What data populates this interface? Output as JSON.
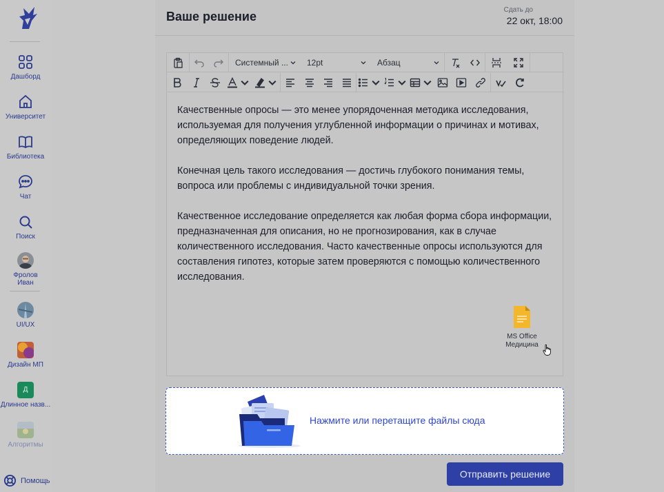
{
  "sidebar": {
    "items": [
      {
        "label": "Дашборд",
        "icon": "grid-icon"
      },
      {
        "label": "Университет",
        "icon": "home-icon"
      },
      {
        "label": "Библиотека",
        "icon": "book-icon"
      },
      {
        "label": "Чат",
        "icon": "chat-icon"
      },
      {
        "label": "Поиск",
        "icon": "search-icon"
      },
      {
        "label": "Фролов Иван",
        "icon": "avatar"
      }
    ],
    "courses": [
      {
        "label": "UI/UX"
      },
      {
        "label": "Дизайн МП"
      },
      {
        "label": "Длинное назв...",
        "letter": "Д"
      },
      {
        "label": "Алгоритмы"
      }
    ],
    "help": "Помощь"
  },
  "header": {
    "title": "Ваше решение",
    "due_label": "Сдать до",
    "due_value": "22 окт, 18:00"
  },
  "toolbar": {
    "font_family": "Системный ...",
    "font_size": "12pt",
    "block_format": "Абзац"
  },
  "content": {
    "paragraphs": [
      "Качественные опросы — это менее упорядоченная методика исследования, используемая для получения углубленной информации о причинах и мотивах, определяющих поведение людей.",
      "Конечная цель такого исследования — достичь глубокого понимания темы, вопроса или проблемы с индивидуальной точки зрения.",
      "Качественное исследование определяется как любая форма сбора информации, предназначенная для описания, но не прогнозирования, как в случае количественного исследования. Часто качественные опросы используются для составления гипотез, которые затем проверяются с помощью количественного исследования."
    ],
    "attachment": {
      "line1": "MS Office",
      "line2": "Медицина"
    }
  },
  "dropzone": {
    "text": "Нажмите или перетащите файлы сюда"
  },
  "submit_label": "Отправить решение",
  "colors": {
    "accent": "#2e3fa6",
    "link": "#2f47cf",
    "file": "#f4b62a"
  }
}
